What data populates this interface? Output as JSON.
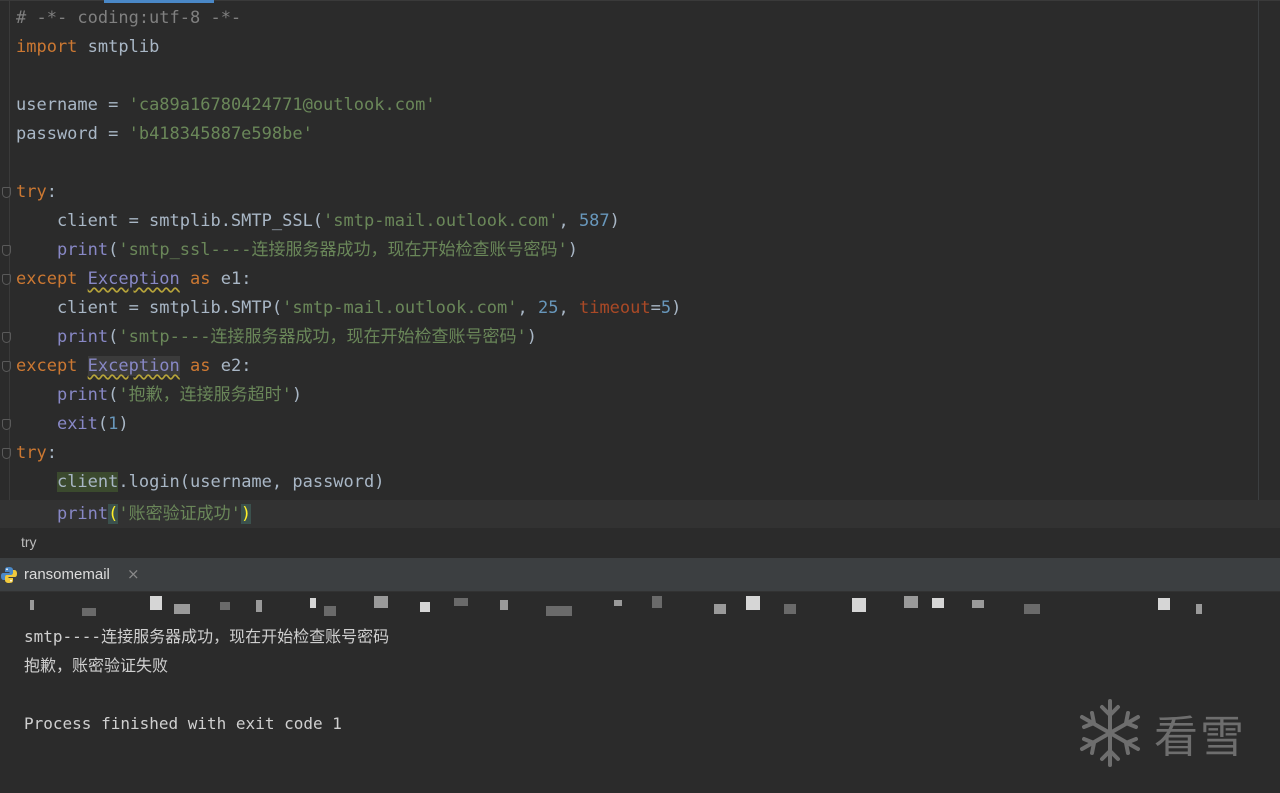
{
  "editor": {
    "lines": [
      [
        {
          "t": "# -*- coding:utf-8 -*-",
          "c": "cmt"
        }
      ],
      [
        {
          "t": "import",
          "c": "kw"
        },
        {
          "t": " smtplib"
        }
      ],
      [],
      [
        {
          "t": "username = "
        },
        {
          "t": "'ca89a16780424771@outlook.com'",
          "c": "str"
        }
      ],
      [
        {
          "t": "password = "
        },
        {
          "t": "'b418345887e598be'",
          "c": "str"
        }
      ],
      [],
      [
        {
          "t": "try",
          "c": "kw"
        },
        {
          "t": ":"
        }
      ],
      [
        {
          "t": "    client = smtplib.SMTP_SSL("
        },
        {
          "t": "'smtp-mail.outlook.com'",
          "c": "str"
        },
        {
          "t": ", "
        },
        {
          "t": "587",
          "c": "num"
        },
        {
          "t": ")"
        }
      ],
      [
        {
          "t": "    "
        },
        {
          "t": "print",
          "c": "builtin"
        },
        {
          "t": "("
        },
        {
          "t": "'smtp_ssl----连接服务器成功，现在开始检查账号密码'",
          "c": "str"
        },
        {
          "t": ")"
        }
      ],
      [
        {
          "t": "except ",
          "c": "kw"
        },
        {
          "t": "Exception",
          "c": "cls"
        },
        {
          "t": " as ",
          "c": "kw"
        },
        {
          "t": "e1:"
        }
      ],
      [
        {
          "t": "    client = smtplib.SMTP("
        },
        {
          "t": "'smtp-mail.outlook.com'",
          "c": "str"
        },
        {
          "t": ", "
        },
        {
          "t": "25",
          "c": "num"
        },
        {
          "t": ", "
        },
        {
          "t": "timeout",
          "c": "param"
        },
        {
          "t": "="
        },
        {
          "t": "5",
          "c": "num"
        },
        {
          "t": ")"
        }
      ],
      [
        {
          "t": "    "
        },
        {
          "t": "print",
          "c": "builtin"
        },
        {
          "t": "("
        },
        {
          "t": "'smtp----连接服务器成功，现在开始检查账号密码'",
          "c": "str"
        },
        {
          "t": ")"
        }
      ],
      [
        {
          "t": "except ",
          "c": "kw"
        },
        {
          "t": "Exception",
          "c": "cls-hl"
        },
        {
          "t": " as ",
          "c": "kw"
        },
        {
          "t": "e2:"
        }
      ],
      [
        {
          "t": "    "
        },
        {
          "t": "print",
          "c": "builtin"
        },
        {
          "t": "("
        },
        {
          "t": "'抱歉，连接服务超时'",
          "c": "str"
        },
        {
          "t": ")"
        }
      ],
      [
        {
          "t": "    "
        },
        {
          "t": "exit",
          "c": "builtin"
        },
        {
          "t": "("
        },
        {
          "t": "1",
          "c": "num"
        },
        {
          "t": ")"
        }
      ],
      [
        {
          "t": "try",
          "c": "kw"
        },
        {
          "t": ":"
        }
      ],
      [
        {
          "t": "    "
        },
        {
          "t": "client",
          "c": "var-hl"
        },
        {
          "t": ".login(username, password)"
        }
      ],
      [
        {
          "t": "    "
        },
        {
          "t": "print",
          "c": "builtin"
        },
        {
          "t": "(",
          "c": "brace-hl"
        },
        {
          "t": "'账密验证成功'",
          "c": "str"
        },
        {
          "t": ")",
          "c": "brace-hl"
        }
      ]
    ]
  },
  "breadcrumb": {
    "label": "try"
  },
  "run_panel": {
    "tab_label": "ransomemail",
    "close_glyph": "×",
    "output": [
      "smtp----连接服务器成功，现在开始检查账号密码",
      "抱歉，账密验证失败",
      "",
      "Process finished with exit code 1"
    ]
  },
  "watermark": {
    "text": "看雪"
  },
  "colors": {
    "background": "#2b2b2b",
    "keyword": "#cc7832",
    "string": "#6a8759",
    "number": "#6897bb",
    "builtin": "#8888c6",
    "parameter": "#aa4926",
    "comment": "#808080"
  },
  "icons": [
    "python-icon",
    "close-icon",
    "snowflake-icon",
    "fold-marker-icon"
  ]
}
